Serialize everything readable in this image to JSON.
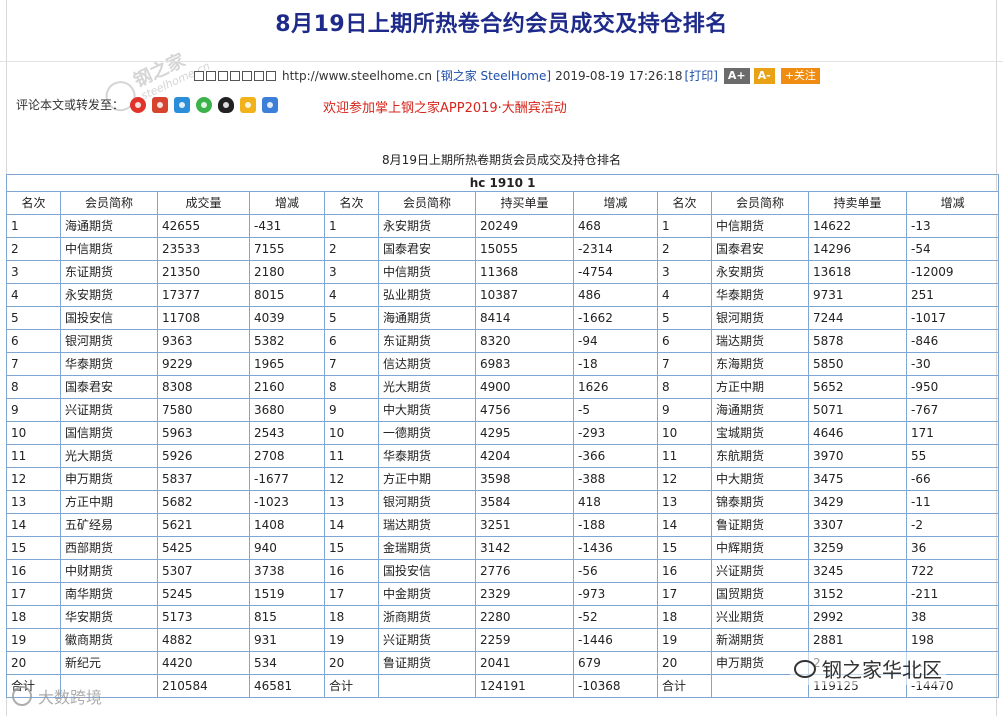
{
  "page": {
    "title": "8月19日上期所热卷合约会员成交及持仓排名",
    "logo": {
      "text": "钢之家",
      "sub": "steelhome.cn"
    }
  },
  "meta": {
    "squares": [
      "□",
      "□",
      "□",
      "□",
      "□",
      "□",
      "□"
    ],
    "url": "http://www.steelhome.cn",
    "source_link": "[钢之家 SteelHome]",
    "datetime": "2019-08-19 17:26:18",
    "print_label": "[打印]",
    "font_larger": "A+",
    "font_smaller": "A-",
    "follow": "+关注"
  },
  "share": {
    "label": "评论本文或转发至：",
    "icons": [
      "weibo-icon",
      "sina-icon",
      "qzone-icon",
      "wechat-icon",
      "qq-icon",
      "favorite-icon",
      "plus-icon"
    ]
  },
  "promo": "欢迎参加掌上钢之家APP2019·大酬宾活动",
  "subtitle": "8月19日上期所热卷期货会员成交及持仓排名",
  "table": {
    "caption": "hc 1910 1",
    "headers": [
      "名次",
      "会员简称",
      "成交量",
      "增减",
      "名次",
      "会员简称",
      "持买单量",
      "增减",
      "名次",
      "会员简称",
      "持卖单量",
      "增减"
    ],
    "rows": [
      [
        "1",
        "海通期货",
        "42655",
        "-431",
        "1",
        "永安期货",
        "20249",
        "468",
        "1",
        "中信期货",
        "14622",
        "-13"
      ],
      [
        "2",
        "中信期货",
        "23533",
        "7155",
        "2",
        "国泰君安",
        "15055",
        "-2314",
        "2",
        "国泰君安",
        "14296",
        "-54"
      ],
      [
        "3",
        "东证期货",
        "21350",
        "2180",
        "3",
        "中信期货",
        "11368",
        "-4754",
        "3",
        "永安期货",
        "13618",
        "-12009"
      ],
      [
        "4",
        "永安期货",
        "17377",
        "8015",
        "4",
        "弘业期货",
        "10387",
        "486",
        "4",
        "华泰期货",
        "9731",
        "251"
      ],
      [
        "5",
        "国投安信",
        "11708",
        "4039",
        "5",
        "海通期货",
        "8414",
        "-1662",
        "5",
        "银河期货",
        "7244",
        "-1017"
      ],
      [
        "6",
        "银河期货",
        "9363",
        "5382",
        "6",
        "东证期货",
        "8320",
        "-94",
        "6",
        "瑞达期货",
        "5878",
        "-846"
      ],
      [
        "7",
        "华泰期货",
        "9229",
        "1965",
        "7",
        "信达期货",
        "6983",
        "-18",
        "7",
        "东海期货",
        "5850",
        "-30"
      ],
      [
        "8",
        "国泰君安",
        "8308",
        "2160",
        "8",
        "光大期货",
        "4900",
        "1626",
        "8",
        "方正中期",
        "5652",
        "-950"
      ],
      [
        "9",
        "兴证期货",
        "7580",
        "3680",
        "9",
        "中大期货",
        "4756",
        "-5",
        "9",
        "海通期货",
        "5071",
        "-767"
      ],
      [
        "10",
        "国信期货",
        "5963",
        "2543",
        "10",
        "一德期货",
        "4295",
        "-293",
        "10",
        "宝城期货",
        "4646",
        "171"
      ],
      [
        "11",
        "光大期货",
        "5926",
        "2708",
        "11",
        "华泰期货",
        "4204",
        "-366",
        "11",
        "东航期货",
        "3970",
        "55"
      ],
      [
        "12",
        "申万期货",
        "5837",
        "-1677",
        "12",
        "方正中期",
        "3598",
        "-388",
        "12",
        "中大期货",
        "3475",
        "-66"
      ],
      [
        "13",
        "方正中期",
        "5682",
        "-1023",
        "13",
        "银河期货",
        "3584",
        "418",
        "13",
        "锦泰期货",
        "3429",
        "-11"
      ],
      [
        "14",
        "五矿经易",
        "5621",
        "1408",
        "14",
        "瑞达期货",
        "3251",
        "-188",
        "14",
        "鲁证期货",
        "3307",
        "-2"
      ],
      [
        "15",
        "西部期货",
        "5425",
        "940",
        "15",
        "金瑞期货",
        "3142",
        "-1436",
        "15",
        "中辉期货",
        "3259",
        "36"
      ],
      [
        "16",
        "中财期货",
        "5307",
        "3738",
        "16",
        "国投安信",
        "2776",
        "-56",
        "16",
        "兴证期货",
        "3245",
        "722"
      ],
      [
        "17",
        "南华期货",
        "5245",
        "1519",
        "17",
        "中金期货",
        "2329",
        "-973",
        "17",
        "国贸期货",
        "3152",
        "-211"
      ],
      [
        "18",
        "华安期货",
        "5173",
        "815",
        "18",
        "浙商期货",
        "2280",
        "-52",
        "18",
        "兴业期货",
        "2992",
        "38"
      ],
      [
        "19",
        "徽商期货",
        "4882",
        "931",
        "19",
        "兴证期货",
        "2259",
        "-1446",
        "19",
        "新湖期货",
        "2881",
        "198"
      ],
      [
        "20",
        "新纪元",
        "4420",
        "534",
        "20",
        "鲁证期货",
        "2041",
        "679",
        "20",
        "申万期货",
        "2…",
        "…"
      ]
    ],
    "total": [
      "合计",
      "",
      "210584",
      "46581",
      "合计",
      "",
      "124191",
      "-10368",
      "合计",
      "",
      "119125",
      "-14470"
    ]
  },
  "watermarks": {
    "left": "大数跨境",
    "right": "钢之家华北区"
  }
}
